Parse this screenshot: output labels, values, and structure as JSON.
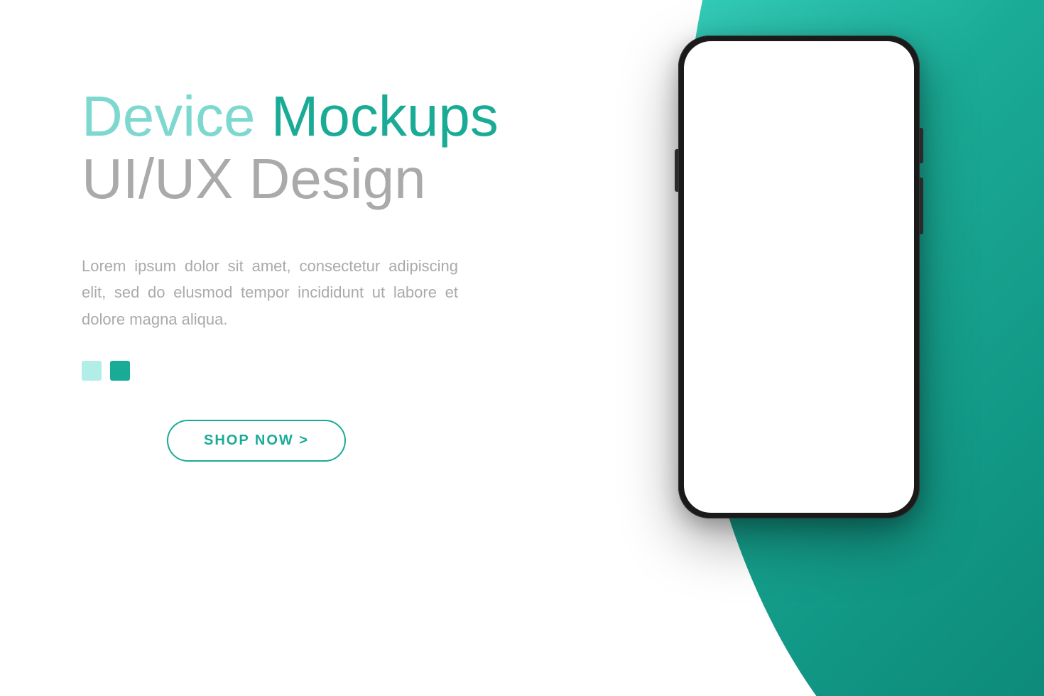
{
  "page": {
    "background": "#ffffff",
    "teal_color": "#1aab96",
    "teal_light": "#7dd8d0"
  },
  "heading": {
    "line1_part1": "Device ",
    "line1_part2": "Mockups",
    "line2": "UI/UX Design"
  },
  "body_text": "Lorem ipsum dolor sit amet, consectetur adipiscing elit, sed do elusmod tempor incididunt ut labore et dolore magna aliqua.",
  "indicators": {
    "dot1_color": "#b2eee8",
    "dot2_color": "#1aab96"
  },
  "button": {
    "label": "SHOP NOW >"
  }
}
